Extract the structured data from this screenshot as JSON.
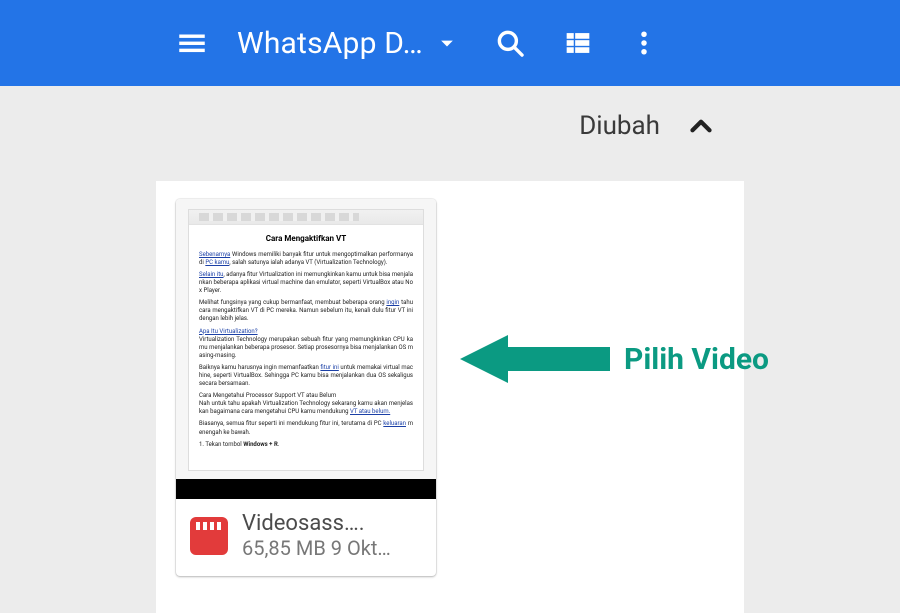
{
  "appbar": {
    "title": "WhatsApp D…"
  },
  "sort": {
    "label": "Diubah"
  },
  "file": {
    "name": "Videosass….",
    "meta": "65,85 MB 9 Okt…",
    "doc_title": "Cara Mengaktifkan VT"
  },
  "annot": {
    "label": "Pilih Video",
    "color": "#0b9a82"
  }
}
